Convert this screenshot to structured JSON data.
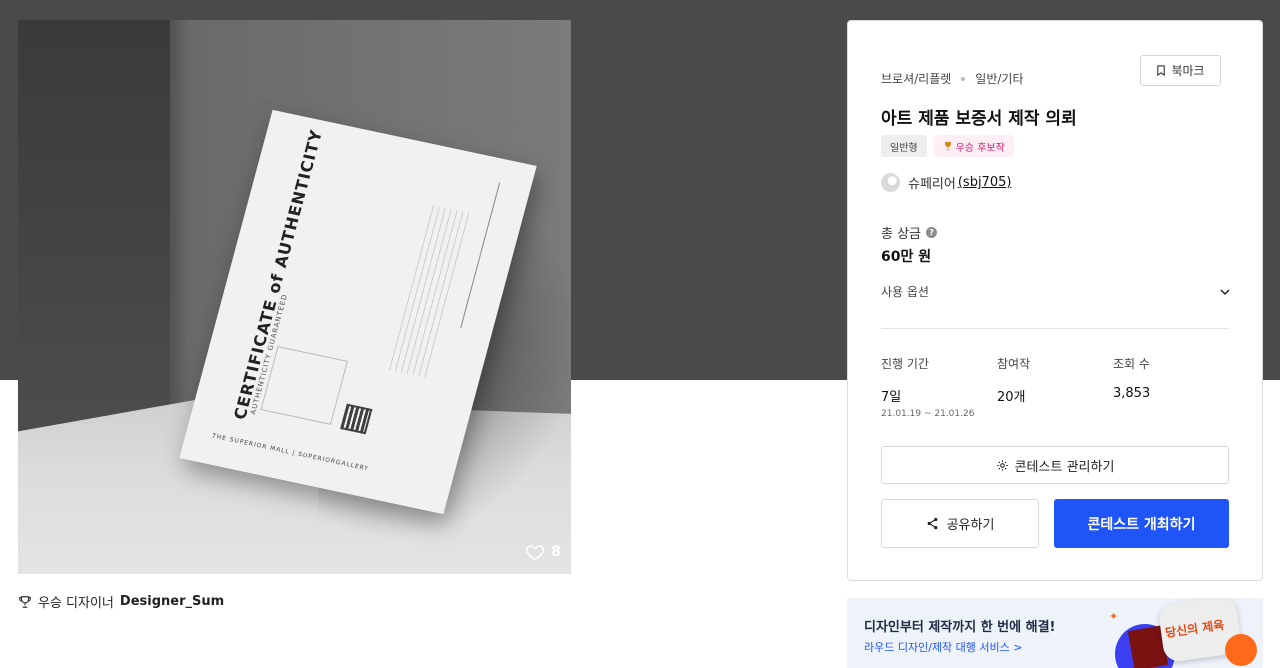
{
  "hero": {
    "likes_count": "8",
    "certificate": {
      "title": "CERTIFICATE of AUTHENTICITY",
      "subtitle": "AUTHENTICITY GUARANTEED",
      "footer": "THE SUPERIOR MALL  |  SUPERIORGALLERY"
    }
  },
  "designer": {
    "prefix": "우승 디자이너",
    "name": "Designer_Sum"
  },
  "panel": {
    "breadcrumb": [
      "브로셔/리플렛",
      "일반/기타"
    ],
    "bookmark_label": "북마크",
    "title": "아트 제품 보증서 제작 의뢰",
    "tags": [
      {
        "label": "일반형"
      },
      {
        "label": "우승 후보작"
      }
    ],
    "author": {
      "name": "슈페리어",
      "handle": "(sbj705)"
    },
    "prize": {
      "label": "총 상금",
      "help": "?",
      "value": "60만 원"
    },
    "usage_label": "사용 옵션",
    "stats": [
      {
        "label": "진행 기간",
        "value": "7일",
        "range": "21.01.19 ~ 21.01.26"
      },
      {
        "label": "참여작",
        "value": "20개"
      },
      {
        "label": "조회 수",
        "value": "3,853"
      }
    ],
    "manage_label": "콘테스트 관리하기",
    "share_label": "공유하기",
    "host_label": "콘테스트 개최하기"
  },
  "banner": {
    "title": "디자인부터 제작까지 한 번에 해결!",
    "link": "라우드 디자인/제작 대행 서비스 >",
    "sign_text": "당신의 제육"
  },
  "colors": {
    "primary": "#1f54f6",
    "top_bg": "#4a4a4a",
    "candidate_tag_bg": "#ffeef5",
    "candidate_tag_text": "#d21a6c",
    "banner_bg": "#eef3fa"
  }
}
